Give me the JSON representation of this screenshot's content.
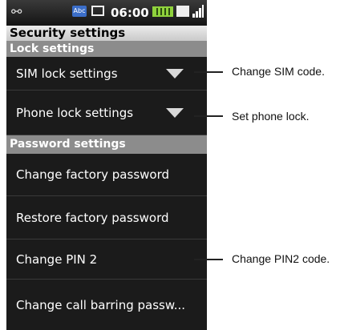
{
  "status_bar": {
    "time": "06:00",
    "input_badge": "Abc",
    "icons": [
      "usb-icon",
      "abc-icon",
      "sms-icon",
      "battery-icon",
      "mail-icon",
      "signal-icon"
    ]
  },
  "title": "Security settings",
  "sections": {
    "lock": "Lock settings",
    "password": "Password settings"
  },
  "items": {
    "sim_lock": "SIM lock settings",
    "phone_lock": "Phone lock settings",
    "change_factory": "Change factory password",
    "restore_factory": "Restore factory password",
    "change_pin2": "Change PIN 2",
    "change_barring": "Change call barring passw..."
  },
  "callouts": {
    "sim": "Change SIM code.",
    "phone": "Set phone lock.",
    "pin2": "Change PIN2 code."
  },
  "colors": {
    "background": "#1b1b1b",
    "section_header": "#8c8c8c",
    "title_bar": "#d9d9d9"
  }
}
